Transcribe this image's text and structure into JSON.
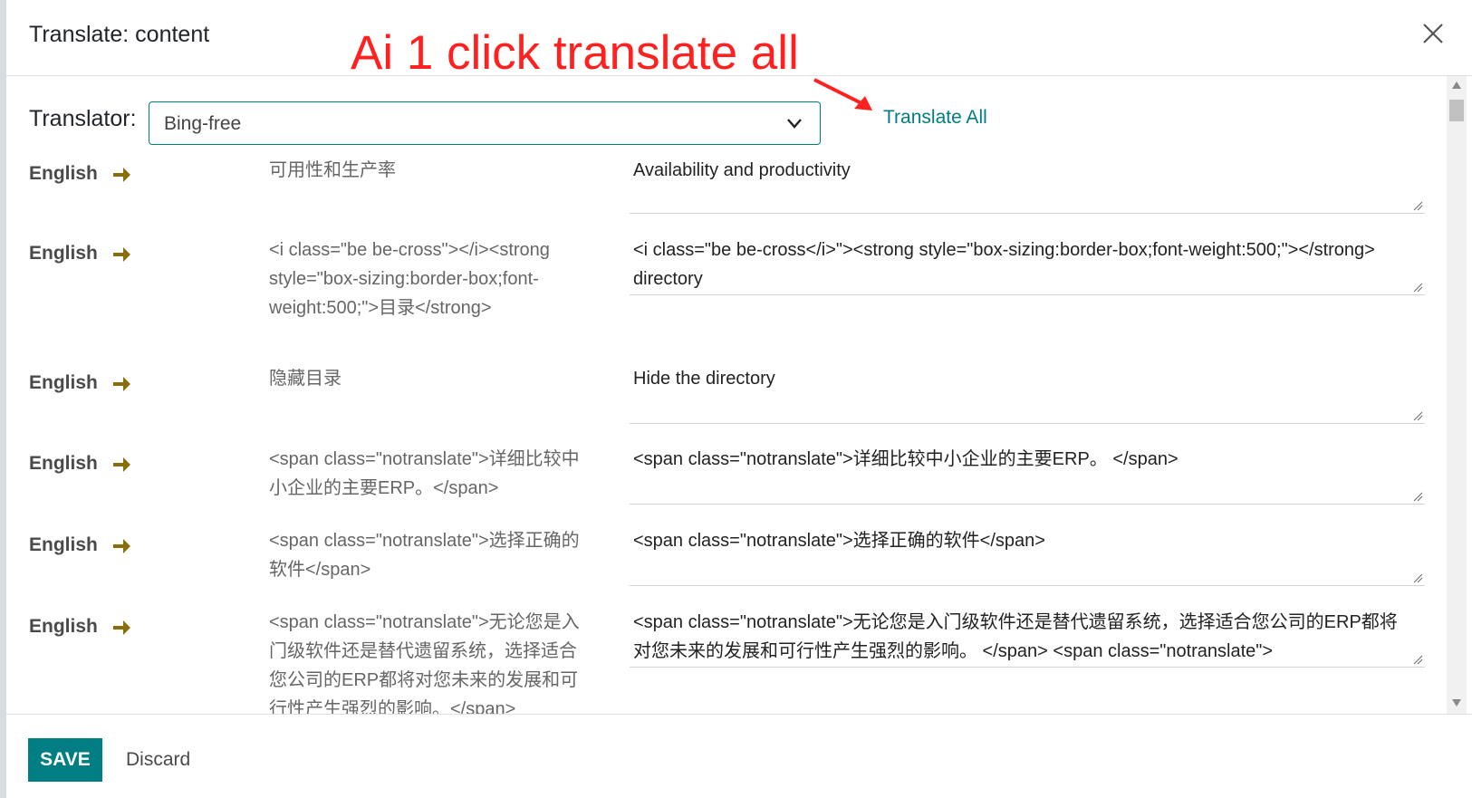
{
  "dialog": {
    "title": "Translate: content",
    "annotation": "Ai 1 click translate all",
    "translator_label": "Translator:",
    "translator_value": "Bing-free",
    "translate_all_label": "Translate All"
  },
  "rows": [
    {
      "lang": "English",
      "source": "可用性和生产率",
      "translation": "Availability and productivity"
    },
    {
      "lang": "English",
      "source": "<i class=\"be be-cross\"></i><strong style=\"box-sizing:border-box;font-weight:500;\">目录</strong>",
      "translation": "<i class=\"be be-cross</i>\"><strong style=\"box-sizing:border-box;font-weight:500;\"></strong> directory"
    },
    {
      "lang": "English",
      "source": "隐藏目录",
      "translation": "Hide the directory"
    },
    {
      "lang": "English",
      "source": "<span class=\"notranslate\">详细比较中小企业的主要ERP。</span>",
      "translation": "<span class=\"notranslate\">详细比较中小企业的主要ERP。 </span>"
    },
    {
      "lang": "English",
      "source": "<span class=\"notranslate\">选择正确的软件</span>",
      "translation": "<span class=\"notranslate\">选择正确的软件</span>"
    },
    {
      "lang": "English",
      "source": "<span class=\"notranslate\">无论您是入门级软件还是替代遗留系统，选择适合您公司的ERP都将对您未来的发展和可行性产生强烈的影响。</span>",
      "translation": "<span class=\"notranslate\">无论您是入门级软件还是替代遗留系统，选择适合您公司的ERP都将对您未来的发展和可行性产生强烈的影响。 </span> <span class=\"notranslate\">"
    }
  ],
  "footer": {
    "save_label": "SAVE",
    "discard_label": "Discard"
  },
  "colors": {
    "accent": "#017e84",
    "annotation": "#ff2020",
    "arrow": "#8a6d0b"
  },
  "icons": {
    "close": "close-icon",
    "dropdown": "chevron-down-icon",
    "lang_arrow": "arrow-right-icon"
  }
}
